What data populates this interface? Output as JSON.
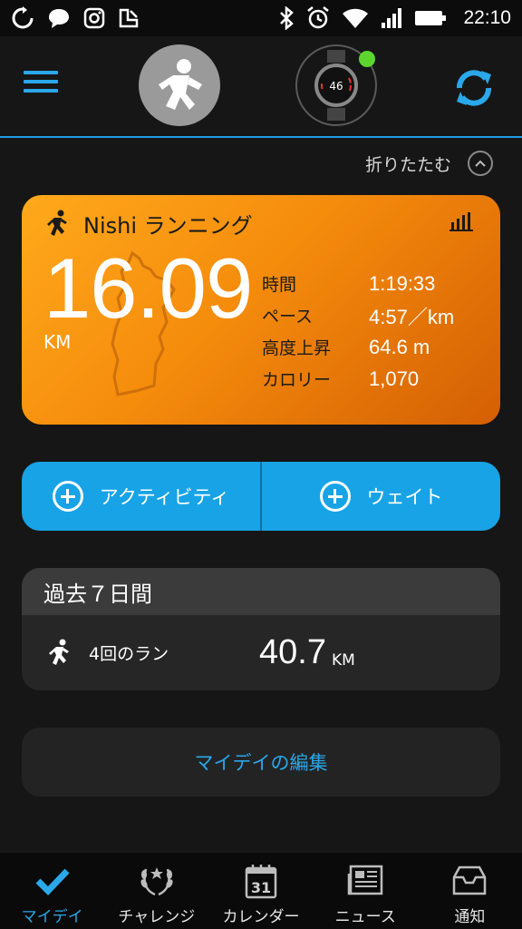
{
  "status_bar": {
    "time": "22:10",
    "left_icons": [
      "sync-status-icon",
      "chat-bubble-icon",
      "instagram-icon",
      "feedly-icon"
    ],
    "right_icons": [
      "bluetooth-icon",
      "alarm-icon",
      "wifi-icon",
      "signal-icon",
      "battery-icon"
    ]
  },
  "header": {
    "watch_face_number": "46",
    "watch_connected_color": "#5cd62e",
    "accent_color": "#1e9ee0"
  },
  "collapse": {
    "label": "折りたたむ"
  },
  "activity_card": {
    "title": "Nishi ランニング",
    "distance": "16.09",
    "distance_unit": "KM",
    "stats": [
      {
        "label": "時間",
        "value": "1:19:33"
      },
      {
        "label": "ペース",
        "value": "4:57／km"
      },
      {
        "label": "高度上昇",
        "value": "64.6 m"
      },
      {
        "label": "カロリー",
        "value": "1,070"
      }
    ],
    "gradient_colors": [
      "#ffa91c",
      "#d45f04"
    ]
  },
  "add_buttons": {
    "activity_label": "アクティビティ",
    "weight_label": "ウェイト"
  },
  "past_week": {
    "title": "過去７日間",
    "runs_label": "4回のラン",
    "distance": "40.7",
    "distance_unit": "KM"
  },
  "edit_my_day": {
    "label": "マイデイの編集"
  },
  "bottom_nav": [
    {
      "label": "マイデイ",
      "icon": "checkmark-icon",
      "active": true
    },
    {
      "label": "チャレンジ",
      "icon": "laurel-icon",
      "active": false
    },
    {
      "label": "カレンダー",
      "icon": "calendar-icon",
      "active": false,
      "calendar_day": "31"
    },
    {
      "label": "ニュース",
      "icon": "newspaper-icon",
      "active": false
    },
    {
      "label": "通知",
      "icon": "inbox-icon",
      "active": false
    }
  ]
}
